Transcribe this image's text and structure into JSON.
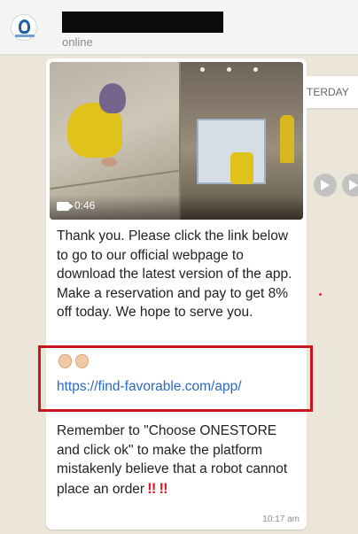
{
  "header": {
    "status": "online"
  },
  "date_divider": "YESTERDAY",
  "message": {
    "video_duration": "0:46",
    "text": "Thank you. Please click the link below to go to our official webpage to download the latest version of the app. Make a reservation and pay to get 8% off today. We hope to serve you.",
    "link": "https://find-favorable.com/app/",
    "text2": "Remember to \"Choose ONESTORE and click ok\" to make the platform mistakenly believe that a robot cannot place an order",
    "exclaim1": "‼",
    "exclaim2": "‼",
    "time": "10:17 am"
  },
  "icons": {
    "forward": "forward-icon",
    "video": "video-camera-icon"
  },
  "colors": {
    "highlight": "#c5161d",
    "link": "#2b68c4",
    "chat_background": "#ece5da"
  }
}
